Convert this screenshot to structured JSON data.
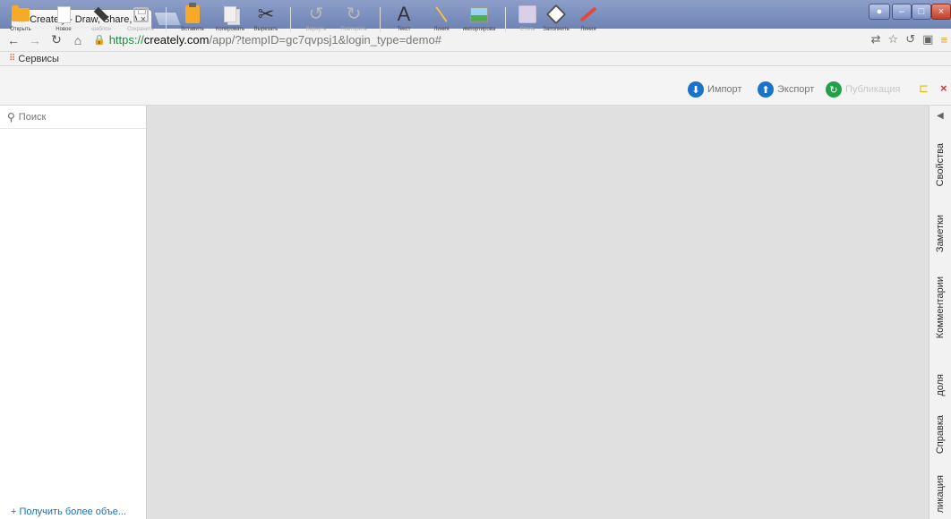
{
  "browser": {
    "tab_title": "Creately - Draw, Share, Va",
    "tab_close": "×",
    "url_scheme": "https://",
    "url_host": "creately.com",
    "url_path": "/app/?tempID=gc7qvpsj1&login_type=demo#",
    "bookmarks_label": "Сервисы",
    "window_close": "×"
  },
  "toolbar": {
    "open": "Открыть",
    "new": "Новое",
    "template": "шаблон",
    "save": "Сохранить",
    "paste": "Вставить",
    "copy": "Копировать",
    "cut": "Вырезать",
    "undo": "Вернуть",
    "redo": "Повторить",
    "text": "Текст",
    "text_glyph": "A",
    "lines": "Линия",
    "import_image": "импортирова",
    "style": "Стиль",
    "fill": "Заполнить",
    "line_color": "Линия",
    "import_btn": "Импорт",
    "export_btn": "Экспорт",
    "publish_btn": "Публикация",
    "close_glyph": "×"
  },
  "left_panel": {
    "search_placeholder": "Поиск",
    "get_more": "+ Получить более объе..."
  },
  "right_tabs": {
    "properties": "Свойства",
    "notes": "Заметки",
    "comments": "Комментарии",
    "share": "доля",
    "help": "Справка",
    "publication": "ликация"
  },
  "colors": {
    "accent_blue": "#1a73c9",
    "publish_green": "#24a148",
    "folder_orange": "#f7a928"
  }
}
